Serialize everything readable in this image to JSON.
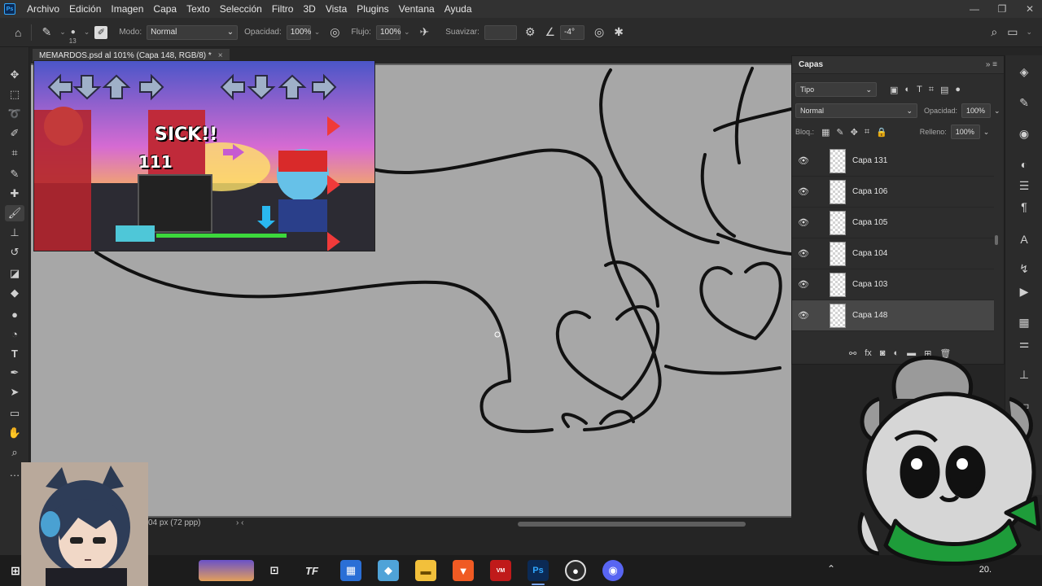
{
  "menubar": {
    "items": [
      "Archivo",
      "Edición",
      "Imagen",
      "Capa",
      "Texto",
      "Selección",
      "Filtro",
      "3D",
      "Vista",
      "Plugins",
      "Ventana",
      "Ayuda"
    ],
    "app_logo": "Ps"
  },
  "options": {
    "brush_size": "13",
    "mode_label": "Modo:",
    "mode_value": "Normal",
    "opacity_label": "Opacidad:",
    "opacity_value": "100%",
    "flow_label": "Flujo:",
    "flow_value": "100%",
    "smooth_label": "Suavizar:",
    "angle_value": "-4°"
  },
  "document": {
    "tab_title": "MEMARDOS.psd al 101% (Capa 148, RGB/8) *",
    "status": "04 px (72 ppp)"
  },
  "layers": {
    "title": "Capas",
    "filter_value": "Tipo",
    "blend_value": "Normal",
    "opacity_label": "Opacidad:",
    "opacity_value": "100%",
    "lock_label": "Bloq.:",
    "fill_label": "Relleno:",
    "fill_value": "100%",
    "items": [
      {
        "name": "Capa 131",
        "selected": false
      },
      {
        "name": "Capa 106",
        "selected": false
      },
      {
        "name": "Capa 105",
        "selected": false
      },
      {
        "name": "Capa 104",
        "selected": false
      },
      {
        "name": "Capa 103",
        "selected": false
      },
      {
        "name": "Capa 148",
        "selected": true
      }
    ]
  },
  "game": {
    "combo_text": "SICK!!",
    "combo_number": "111"
  },
  "taskbar": {
    "apps": [
      "file-explorer",
      "task-view",
      "tf-app",
      "calculator",
      "notes",
      "folder",
      "brave",
      "voice-meeter",
      "photoshop",
      "obs",
      "discord"
    ],
    "clock": "20."
  },
  "colors": {
    "accent": "#31a8ff",
    "canvas": "#a7a7a7",
    "panel": "#2d2d2d"
  }
}
